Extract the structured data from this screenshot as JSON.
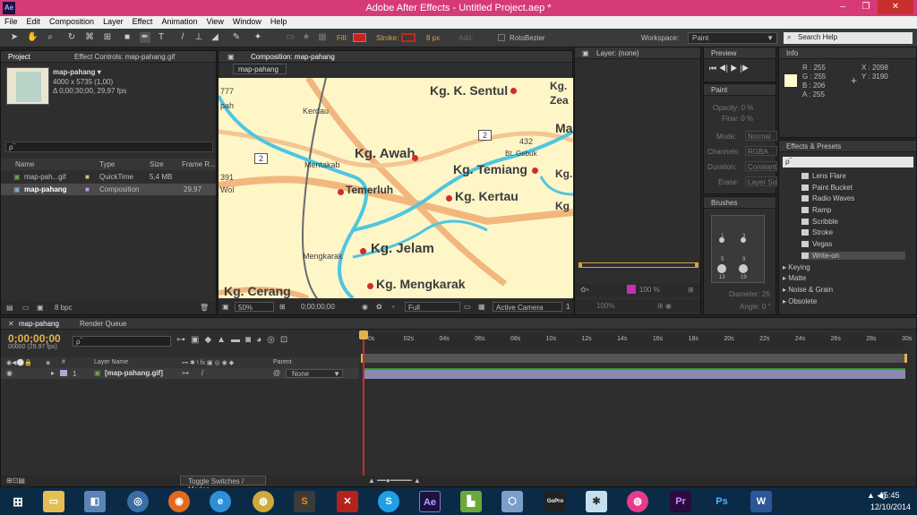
{
  "window": {
    "title": "Adobe After Effects - Untitled Project.aep *",
    "app_icon": "Ae",
    "minimize": "‒",
    "maximize": "❐",
    "close": "✕"
  },
  "menu": [
    "File",
    "Edit",
    "Composition",
    "Layer",
    "Effect",
    "Animation",
    "View",
    "Window",
    "Help"
  ],
  "toolbar": {
    "fill_label": "Fill:",
    "stroke_label": "Stroke:",
    "stroke_size": "8 px",
    "add_label": "Add:",
    "rotobezier": "RotoBezier",
    "workspace_label": "Workspace:",
    "workspace_value": "Paint",
    "search_help": "Search Help",
    "fill_color": "#c8241f",
    "stroke_color": "#c8241f"
  },
  "project": {
    "tab": "Project",
    "effect_controls_tab": "Effect Controls: map-pahang.gif",
    "item_name": "map-pahang ▾",
    "item_dims": "4000 x 5735 (1,00)",
    "item_duration": "Δ 0;00;30;00, 29,97 fps",
    "search_placeholder": "ρ‾",
    "columns": {
      "name": "Name",
      "type": "Type",
      "size": "Size",
      "frame_rate": "Frame R..."
    },
    "items": [
      {
        "name": "map-pah...gif",
        "type": "QuickTime",
        "size": "5,4 MB",
        "fps": ""
      },
      {
        "name": "map-pahang",
        "type": "Composition",
        "size": "",
        "fps": "29,97"
      }
    ],
    "bpc": "8 bpc"
  },
  "composition": {
    "tab": "Composition: map-pahang",
    "crumb": "map-pahang",
    "zoom": "50%",
    "timecode": "0;00;00;00",
    "resolution": "Full",
    "camera": "Active Camera",
    "views": "1"
  },
  "map": {
    "labels": [
      "Kg. K. Sentul",
      "Kg.",
      "Zea",
      "Kerdau",
      "Kg. Awah",
      "Kg. Temiang",
      "Bt. Gebuk",
      "Mentakab",
      "Temerluh",
      "Kg. Kertau",
      "Kg. Jelam",
      "Mengkarak",
      "Kg. Mengkarak",
      "Kg. Cerang",
      "Wol",
      "391",
      "432",
      "Ma",
      "Kg.",
      "2",
      "2",
      "777",
      "pah",
      "Kg"
    ]
  },
  "layer": {
    "tab": "Layer: (none)",
    "zoom": "100 %",
    "zoom2": "100%"
  },
  "preview": {
    "tab": "Preview"
  },
  "paint": {
    "tab": "Paint",
    "opacity": "Opacity: 0 %",
    "flow": "Flow: 0 %",
    "mode_label": "Mode:",
    "mode_value": "Normal",
    "channels_label": "Channels:",
    "channels_value": "RGBA",
    "duration_label": "Duration:",
    "duration_value": "Constant",
    "erase_label": "Erase:",
    "erase_value": "Layer Source"
  },
  "brushes": {
    "tab": "Brushes",
    "sizes": [
      "1",
      "3",
      "5",
      "9",
      "13",
      "19"
    ],
    "diameter": "Diameter: 25",
    "angle": "Angle: 0 °"
  },
  "info": {
    "tab": "Info",
    "r": "R : 255",
    "g": "G : 255",
    "b": "B : 206",
    "a": "A : 255",
    "x": "X : 2098",
    "y": "Y : 3190",
    "swatch": "#fffcce"
  },
  "effects": {
    "tab": "Effects & Presets",
    "search_placeholder": "ρ‾",
    "items": [
      "Lens Flare",
      "Paint Bucket",
      "Radio Waves",
      "Ramp",
      "Scribble",
      "Stroke",
      "Vegas",
      "Write-on"
    ],
    "groups": [
      "Keying",
      "Matte",
      "Noise & Grain",
      "Obsolete"
    ]
  },
  "timeline": {
    "tab": "map-pahang",
    "render_tab": "Render Queue",
    "timecode": "0;00;00;00",
    "frames": "00000 (29.97 fps)",
    "search_placeholder": "ρ‾",
    "col_layer_name": "Layer Name",
    "col_parent": "Parent",
    "layer_num": "1",
    "layer_name": "[map-pahang.gif]",
    "parent": "None",
    "toggle": "Toggle Switches / Modes",
    "ticks": [
      "0s",
      "02s",
      "04s",
      "06s",
      "08s",
      "10s",
      "12s",
      "14s",
      "16s",
      "18s",
      "20s",
      "22s",
      "24s",
      "26s",
      "28s",
      "30s"
    ]
  },
  "taskbar": {
    "time": "15:45",
    "date": "12/10/2014",
    "icons": [
      "start",
      "file-explorer",
      "app-1",
      "network",
      "firefox",
      "internet-explorer",
      "chrome",
      "sublime",
      "filezilla",
      "skype",
      "after-effects",
      "pharos",
      "virtualbox",
      "gopro",
      "remote",
      "fraps",
      "premiere",
      "photoshop",
      "word"
    ]
  }
}
